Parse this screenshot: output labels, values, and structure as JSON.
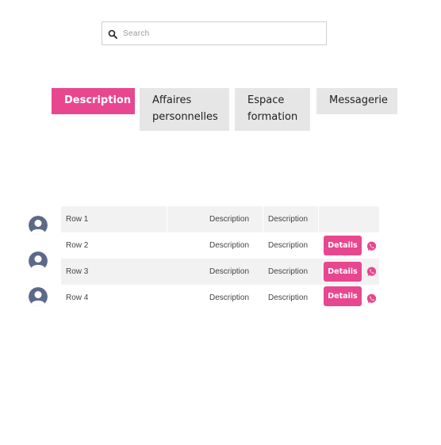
{
  "search": {
    "placeholder": "Search",
    "value": "",
    "icon": "search-icon"
  },
  "tabs": [
    {
      "label": "Description",
      "active": true
    },
    {
      "label": "Affaires personnelles",
      "active": false
    },
    {
      "label": "Espace formation",
      "active": false
    },
    {
      "label": "Messagerie",
      "active": false
    }
  ],
  "table": {
    "rows": [
      {
        "name": "Row 1",
        "col2": "Description",
        "col3": "Description"
      },
      {
        "name": "Row 2",
        "col2": "Description",
        "col3": "Description",
        "action_label": "Details"
      },
      {
        "name": "Row 3",
        "col2": "Description",
        "col3": "Description",
        "action_label": "Details"
      },
      {
        "name": "Row 4",
        "col2": "Description",
        "col3": "Description",
        "action_label": "Details"
      }
    ]
  },
  "colors": {
    "accent": "#e8478f",
    "tab_inactive": "#e6e6e6",
    "row_shade": "#f2f2f2",
    "avatar": "#5c6a8a",
    "whatsapp_icon": "#e8478f"
  },
  "icons": {
    "avatar": "user-avatar-icon",
    "whatsapp": "whatsapp-icon"
  }
}
